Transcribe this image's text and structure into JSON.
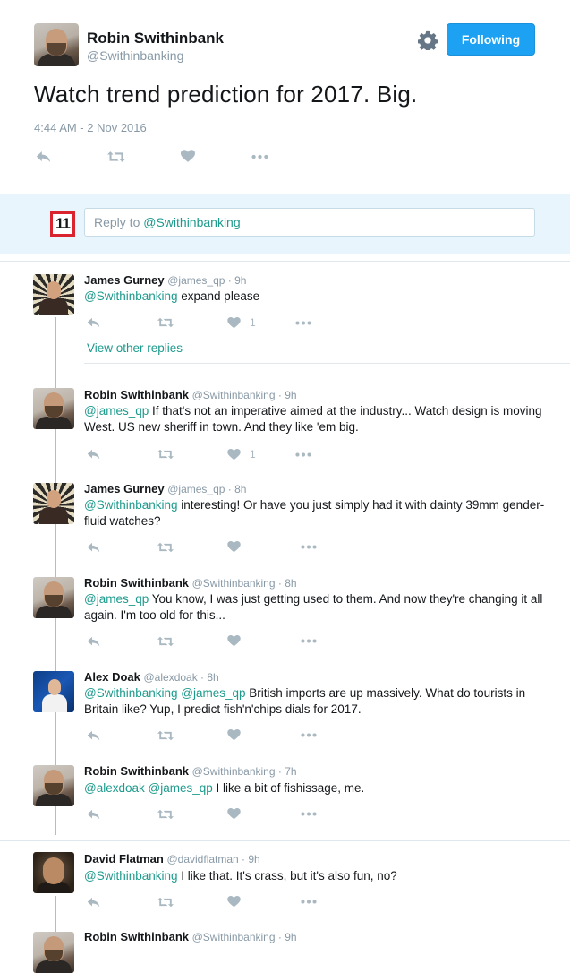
{
  "main_tweet": {
    "name": "Robin Swithinbank",
    "handle": "@Swithinbanking",
    "follow_label": "Following",
    "text": "Watch trend prediction for 2017. Big.",
    "timestamp": "4:44 AM - 2 Nov 2016"
  },
  "reply_box": {
    "label": "Reply to",
    "mention": "@Swithinbanking",
    "logo_text": "11"
  },
  "view_other_replies": "View other replies",
  "replies": [
    {
      "name": "James Gurney",
      "meta": "@james_qp · 9h",
      "mentions": "@Swithinbanking",
      "text": " expand please",
      "likes": "1"
    },
    {
      "name": "Robin Swithinbank",
      "meta": "@Swithinbanking · 9h",
      "mentions": "@james_qp",
      "text": " If that's not an imperative aimed at the industry... Watch design is moving West. US new sheriff in town. And they like 'em big.",
      "likes": "1"
    },
    {
      "name": "James Gurney",
      "meta": "@james_qp · 8h",
      "mentions": "@Swithinbanking",
      "text": " interesting! Or have you just simply had it with dainty 39mm gender-fluid watches?",
      "likes": ""
    },
    {
      "name": "Robin Swithinbank",
      "meta": "@Swithinbanking · 8h",
      "mentions": "@james_qp",
      "text": " You know, I was just getting used to them. And now they're changing it all again. I'm too old for this...",
      "likes": ""
    },
    {
      "name": "Alex Doak",
      "meta": "@alexdoak · 8h",
      "mentions": "@Swithinbanking @james_qp",
      "text": " British imports are up massively. What do tourists in Britain like? Yup, I predict fish'n'chips dials for 2017.",
      "likes": ""
    },
    {
      "name": "Robin Swithinbank",
      "meta": "@Swithinbanking · 7h",
      "mentions": "@alexdoak @james_qp",
      "text": " I like a bit of fishissage, me.",
      "likes": ""
    },
    {
      "name": "David Flatman",
      "meta": "@davidflatman · 9h",
      "mentions": "@Swithinbanking",
      "text": " I like that. It's crass,  but it's also fun, no?",
      "likes": ""
    },
    {
      "name": "Robin Swithinbank",
      "meta": "@Swithinbanking · 9h",
      "mentions": "",
      "text": "",
      "likes": ""
    }
  ],
  "colors": {
    "accent": "#1da1f2",
    "mention": "#1c9a8c",
    "thread_line": "#8ad1c8",
    "reply_band": "#e8f5fd",
    "icon": "#aab8c2"
  },
  "icons": [
    "settings-gear-icon",
    "reply-icon",
    "retweet-icon",
    "like-heart-icon",
    "more-dots-icon"
  ]
}
